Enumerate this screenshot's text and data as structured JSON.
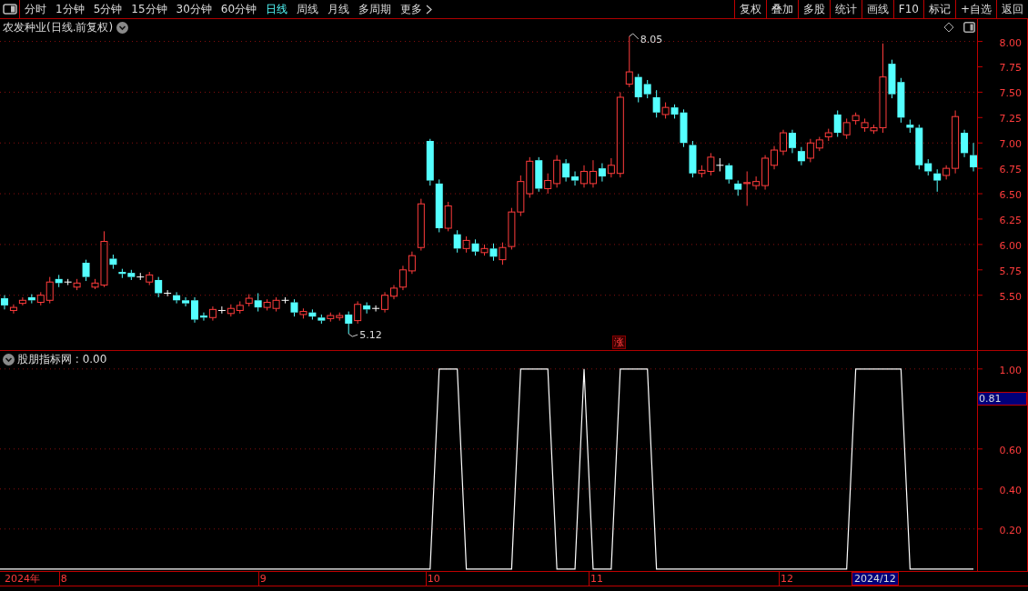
{
  "toolbar": {
    "periods": [
      {
        "label": "分时",
        "selected": false
      },
      {
        "label": "1分钟",
        "selected": false
      },
      {
        "label": "5分钟",
        "selected": false
      },
      {
        "label": "15分钟",
        "selected": false
      },
      {
        "label": "30分钟",
        "selected": false
      },
      {
        "label": "60分钟",
        "selected": false
      },
      {
        "label": "日线",
        "selected": true
      },
      {
        "label": "周线",
        "selected": false
      },
      {
        "label": "月线",
        "selected": false
      },
      {
        "label": "多周期",
        "selected": false
      }
    ],
    "more": "更多",
    "actions": [
      "复权",
      "叠加",
      "多股",
      "统计",
      "画线",
      "F10",
      "标记",
      "+自选",
      "返回"
    ]
  },
  "price_panel": {
    "title": "农发种业(日线.前复权)",
    "signal_badge": "涨",
    "chart_data": {
      "type": "candlestick",
      "ylim": [
        4.96,
        8.22
      ],
      "grid": true,
      "ohlc": [
        [
          5.47,
          5.5,
          5.36,
          5.4
        ],
        [
          5.35,
          5.41,
          5.32,
          5.38
        ],
        [
          5.42,
          5.48,
          5.4,
          5.45
        ],
        [
          5.48,
          5.51,
          5.42,
          5.45
        ],
        [
          5.43,
          5.53,
          5.4,
          5.5
        ],
        [
          5.45,
          5.68,
          5.42,
          5.63
        ],
        [
          5.66,
          5.7,
          5.58,
          5.62
        ],
        [
          5.63,
          5.66,
          5.6,
          5.63
        ],
        [
          5.58,
          5.66,
          5.55,
          5.62
        ],
        [
          5.82,
          5.85,
          5.64,
          5.68
        ],
        [
          5.58,
          5.66,
          5.56,
          5.62
        ],
        [
          5.6,
          6.13,
          5.58,
          6.03
        ],
        [
          5.86,
          5.9,
          5.76,
          5.8
        ],
        [
          5.73,
          5.76,
          5.67,
          5.71
        ],
        [
          5.72,
          5.75,
          5.65,
          5.68
        ],
        [
          5.68,
          5.72,
          5.65,
          5.68
        ],
        [
          5.63,
          5.73,
          5.6,
          5.7
        ],
        [
          5.65,
          5.68,
          5.48,
          5.52
        ],
        [
          5.52,
          5.55,
          5.49,
          5.52
        ],
        [
          5.5,
          5.53,
          5.42,
          5.45
        ],
        [
          5.45,
          5.48,
          5.39,
          5.42
        ],
        [
          5.45,
          5.48,
          5.23,
          5.26
        ],
        [
          5.3,
          5.33,
          5.25,
          5.28
        ],
        [
          5.28,
          5.39,
          5.25,
          5.36
        ],
        [
          5.35,
          5.39,
          5.32,
          5.35
        ],
        [
          5.32,
          5.41,
          5.29,
          5.37
        ],
        [
          5.35,
          5.44,
          5.32,
          5.4
        ],
        [
          5.42,
          5.51,
          5.39,
          5.47
        ],
        [
          5.45,
          5.52,
          5.34,
          5.38
        ],
        [
          5.38,
          5.46,
          5.35,
          5.43
        ],
        [
          5.37,
          5.48,
          5.34,
          5.45
        ],
        [
          5.45,
          5.48,
          5.42,
          5.45
        ],
        [
          5.43,
          5.46,
          5.29,
          5.33
        ],
        [
          5.31,
          5.37,
          5.27,
          5.34
        ],
        [
          5.33,
          5.36,
          5.26,
          5.29
        ],
        [
          5.28,
          5.31,
          5.22,
          5.25
        ],
        [
          5.27,
          5.33,
          5.24,
          5.3
        ],
        [
          5.28,
          5.33,
          5.25,
          5.3
        ],
        [
          5.31,
          5.34,
          5.12,
          5.22
        ],
        [
          5.25,
          5.44,
          5.22,
          5.41
        ],
        [
          5.4,
          5.43,
          5.32,
          5.36
        ],
        [
          5.37,
          5.4,
          5.34,
          5.37
        ],
        [
          5.36,
          5.53,
          5.33,
          5.5
        ],
        [
          5.49,
          5.6,
          5.46,
          5.57
        ],
        [
          5.58,
          5.79,
          5.55,
          5.75
        ],
        [
          5.74,
          5.93,
          5.71,
          5.89
        ],
        [
          5.97,
          6.45,
          5.94,
          6.4
        ],
        [
          7.02,
          7.04,
          6.58,
          6.63
        ],
        [
          6.6,
          6.64,
          6.12,
          6.16
        ],
        [
          6.16,
          6.42,
          6.13,
          6.38
        ],
        [
          6.1,
          6.14,
          5.92,
          5.96
        ],
        [
          5.96,
          6.08,
          5.92,
          6.04
        ],
        [
          6.01,
          6.05,
          5.89,
          5.93
        ],
        [
          5.92,
          6.0,
          5.89,
          5.96
        ],
        [
          5.96,
          6.01,
          5.84,
          5.88
        ],
        [
          5.85,
          6.02,
          5.8,
          5.97
        ],
        [
          5.98,
          6.36,
          5.95,
          6.32
        ],
        [
          6.32,
          6.68,
          6.28,
          6.62
        ],
        [
          6.5,
          6.86,
          6.46,
          6.82
        ],
        [
          6.83,
          6.86,
          6.52,
          6.55
        ],
        [
          6.55,
          6.7,
          6.5,
          6.63
        ],
        [
          6.6,
          6.88,
          6.56,
          6.83
        ],
        [
          6.8,
          6.84,
          6.62,
          6.66
        ],
        [
          6.67,
          6.72,
          6.58,
          6.63
        ],
        [
          6.6,
          6.78,
          6.56,
          6.72
        ],
        [
          6.6,
          6.83,
          6.56,
          6.72
        ],
        [
          6.75,
          6.8,
          6.62,
          6.67
        ],
        [
          6.7,
          6.85,
          6.66,
          6.78
        ],
        [
          6.7,
          7.5,
          6.66,
          7.45
        ],
        [
          7.58,
          8.05,
          7.55,
          7.7
        ],
        [
          7.65,
          7.68,
          7.4,
          7.45
        ],
        [
          7.58,
          7.62,
          7.44,
          7.48
        ],
        [
          7.45,
          7.52,
          7.25,
          7.3
        ],
        [
          7.28,
          7.4,
          7.24,
          7.35
        ],
        [
          7.35,
          7.38,
          7.24,
          7.28
        ],
        [
          7.3,
          7.33,
          6.96,
          7.0
        ],
        [
          6.98,
          7.02,
          6.66,
          6.7
        ],
        [
          6.7,
          6.78,
          6.66,
          6.73
        ],
        [
          6.72,
          6.9,
          6.68,
          6.86
        ],
        [
          6.78,
          6.85,
          6.72,
          6.78
        ],
        [
          6.78,
          6.8,
          6.6,
          6.64
        ],
        [
          6.6,
          6.63,
          6.48,
          6.54
        ],
        [
          6.6,
          6.72,
          6.38,
          6.61
        ],
        [
          6.58,
          6.67,
          6.54,
          6.62
        ],
        [
          6.58,
          6.88,
          6.54,
          6.85
        ],
        [
          6.78,
          6.97,
          6.74,
          6.93
        ],
        [
          6.92,
          7.13,
          6.88,
          7.1
        ],
        [
          7.1,
          7.13,
          6.9,
          6.95
        ],
        [
          6.92,
          6.96,
          6.78,
          6.82
        ],
        [
          6.85,
          7.04,
          6.81,
          7.0
        ],
        [
          6.95,
          7.06,
          6.92,
          7.03
        ],
        [
          7.06,
          7.14,
          7.02,
          7.1
        ],
        [
          7.28,
          7.32,
          7.06,
          7.1
        ],
        [
          7.08,
          7.24,
          7.04,
          7.2
        ],
        [
          7.22,
          7.3,
          7.18,
          7.27
        ],
        [
          7.15,
          7.24,
          7.11,
          7.2
        ],
        [
          7.12,
          7.18,
          7.09,
          7.15
        ],
        [
          7.15,
          7.98,
          7.1,
          7.65
        ],
        [
          7.78,
          7.82,
          7.44,
          7.48
        ],
        [
          7.6,
          7.64,
          7.2,
          7.25
        ],
        [
          7.18,
          7.23,
          7.1,
          7.15
        ],
        [
          7.15,
          7.18,
          6.74,
          6.78
        ],
        [
          6.8,
          6.84,
          6.68,
          6.72
        ],
        [
          6.7,
          6.74,
          6.52,
          6.63
        ],
        [
          6.68,
          6.78,
          6.64,
          6.75
        ],
        [
          6.75,
          7.32,
          6.7,
          7.26
        ],
        [
          7.1,
          7.13,
          6.86,
          6.9
        ],
        [
          6.88,
          7.0,
          6.72,
          6.76
        ]
      ],
      "yticks": [
        {
          "value": 8,
          "label": "8.00"
        },
        {
          "value": 7.75,
          "label": "7.75"
        },
        {
          "value": 7.5,
          "label": "7.50"
        },
        {
          "value": 7.25,
          "label": "7.25"
        },
        {
          "value": 7,
          "label": "7.00"
        },
        {
          "value": 6.75,
          "label": "6.75"
        },
        {
          "value": 6.5,
          "label": "6.50"
        },
        {
          "value": 6.25,
          "label": "6.25"
        },
        {
          "value": 6,
          "label": "6.00"
        },
        {
          "value": 5.75,
          "label": "5.75"
        },
        {
          "value": 5.5,
          "label": "5.50"
        }
      ],
      "annotations": [
        "8.05",
        "5.12"
      ]
    }
  },
  "indicator_panel": {
    "title": "股朋指标网 : 0.00",
    "cursor_value": "0.81",
    "chart_data": {
      "type": "line",
      "ylim": [
        -0.01,
        1.09
      ],
      "grid": true,
      "series": [
        {
          "color": "#ffffff",
          "values": [
            0,
            0,
            0,
            0,
            0,
            0,
            0,
            0,
            0,
            0,
            0,
            0,
            0,
            0,
            0,
            0,
            0,
            0,
            0,
            0,
            0,
            0,
            0,
            0,
            0,
            0,
            0,
            0,
            0,
            0,
            0,
            0,
            0,
            0,
            0,
            0,
            0,
            0,
            0,
            0,
            0,
            0,
            0,
            0,
            0,
            0,
            0,
            0,
            1,
            1,
            1,
            0,
            0,
            0,
            0,
            0,
            0,
            1,
            1,
            1,
            1,
            0,
            0,
            0,
            1,
            0,
            0,
            0,
            1,
            1,
            1,
            1,
            0,
            0,
            0,
            0,
            0,
            0,
            0,
            0,
            0,
            0,
            0,
            0,
            0,
            0,
            0,
            0,
            0,
            0,
            0,
            0,
            0,
            0,
            1,
            1,
            1,
            1,
            1,
            1,
            0,
            0,
            0,
            0,
            0,
            0,
            0,
            0
          ]
        }
      ],
      "yticks": [
        {
          "value": 1,
          "label": "1.00"
        },
        {
          "value": 0.6,
          "label": "0.60"
        },
        {
          "value": 0.4,
          "label": "0.40"
        },
        {
          "value": 0.2,
          "label": "0.20"
        }
      ]
    }
  },
  "time_axis": {
    "year_label": "2024年",
    "labels": [
      "8",
      "9",
      "10",
      "11",
      "12"
    ],
    "cursor_label": "2024/12"
  }
}
